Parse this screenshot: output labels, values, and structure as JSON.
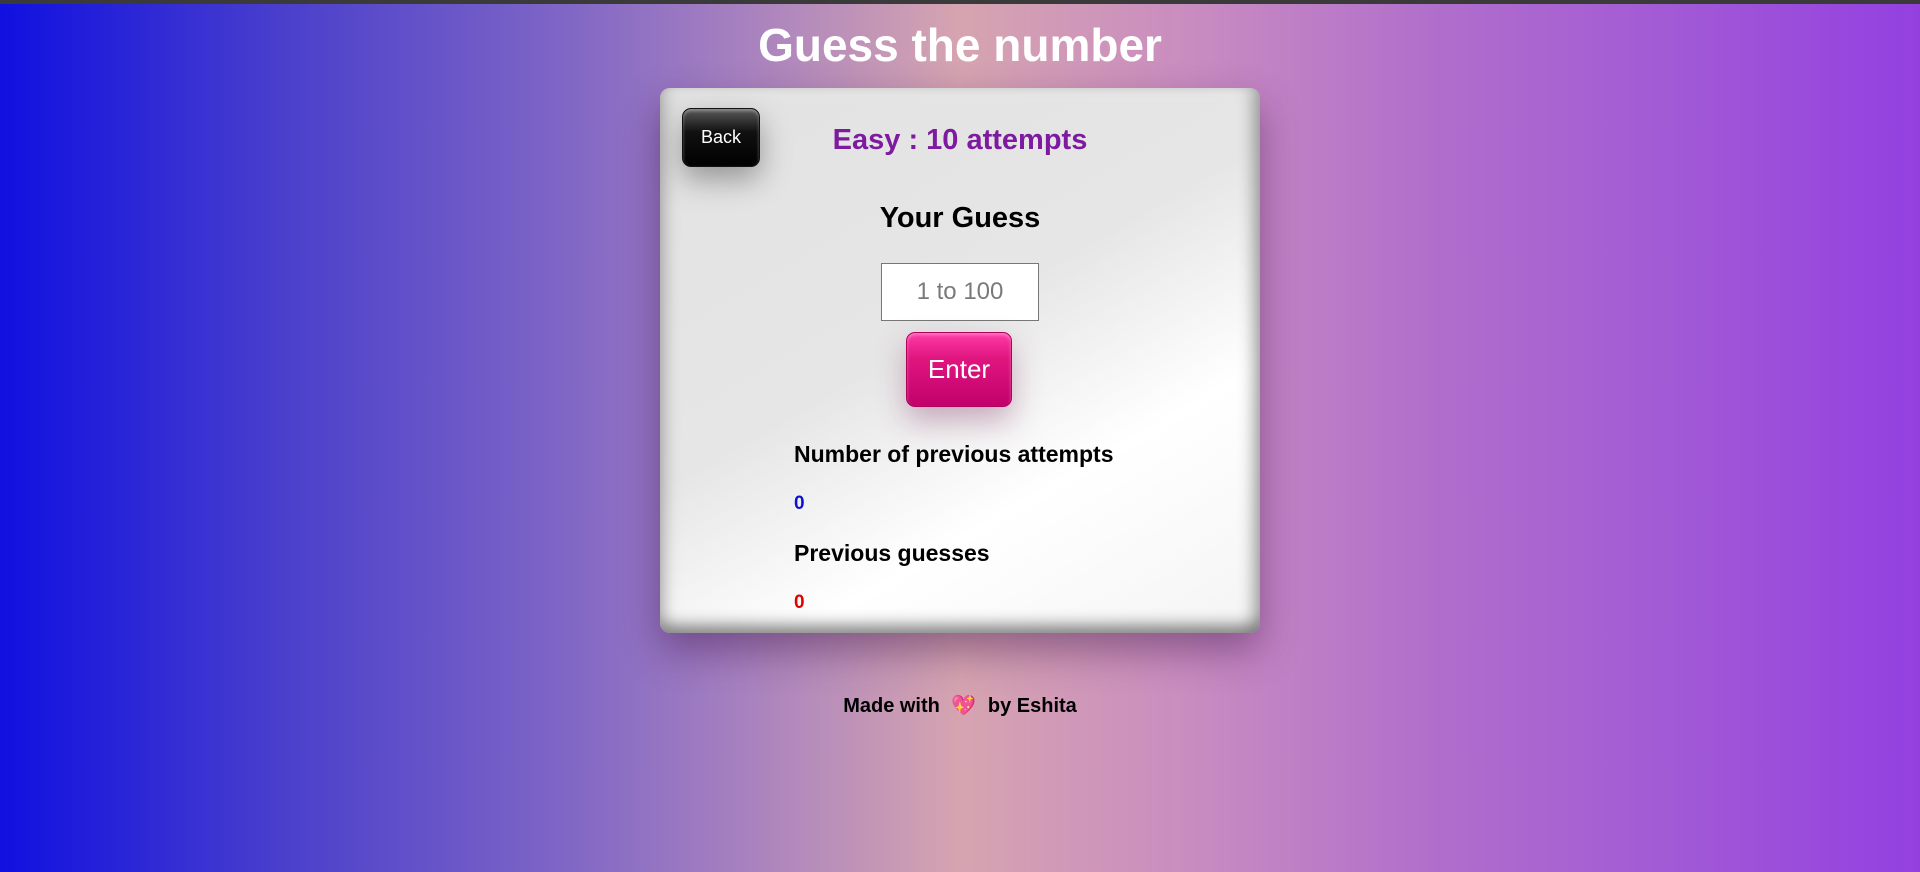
{
  "app": {
    "title": "Guess the number"
  },
  "card": {
    "back_label": "Back",
    "difficulty": "Easy : 10 attempts",
    "guess_label": "Your Guess",
    "guess_input": {
      "placeholder": "1 to 100",
      "value": ""
    },
    "enter_label": "Enter",
    "attempts_label": "Number of previous attempts",
    "attempts_value": "0",
    "guesses_label": "Previous guesses",
    "guesses_value": "0"
  },
  "footer": {
    "prefix": "Made with",
    "icon": "heart-icon",
    "suffix": "by Eshita"
  },
  "colors": {
    "difficulty": "#7d1aa0",
    "enter_button": "#e0167f",
    "attempts_value": "#1010d0",
    "guesses_value": "#e00000"
  }
}
